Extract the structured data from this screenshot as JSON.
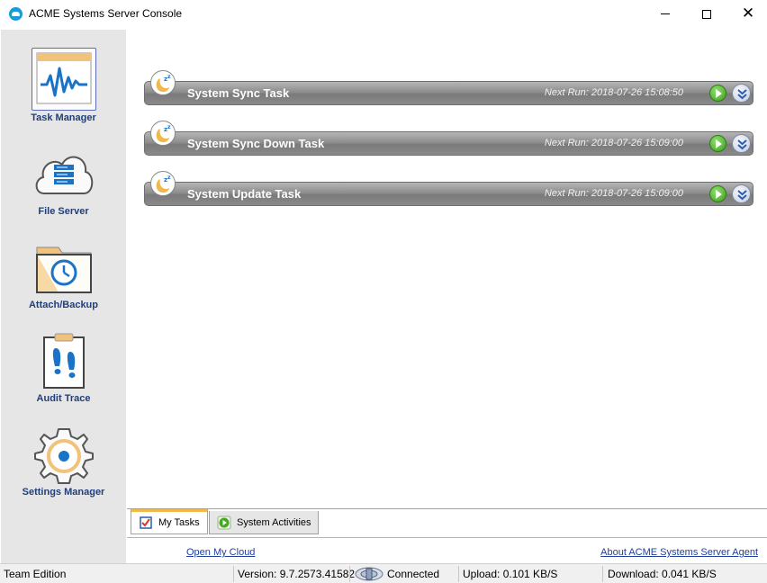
{
  "window": {
    "title": "ACME Systems Server Console",
    "icon": "cloud-icon"
  },
  "sidebar": {
    "items": [
      {
        "label": "Task Manager",
        "icon": "task-manager-icon",
        "active": true
      },
      {
        "label": "File Server",
        "icon": "file-server-icon",
        "active": false
      },
      {
        "label": "Attach/Backup",
        "icon": "attach-backup-icon",
        "active": false
      },
      {
        "label": "Audit Trace",
        "icon": "audit-trace-icon",
        "active": false
      },
      {
        "label": "Settings Manager",
        "icon": "settings-gear-icon",
        "active": false
      }
    ]
  },
  "tasks": [
    {
      "name": "System Sync Task",
      "next_run": "Next Run: 2018-07-26 15:08:50"
    },
    {
      "name": "System Sync Down Task",
      "next_run": "Next Run: 2018-07-26 15:09:00"
    },
    {
      "name": "System Update Task",
      "next_run": "Next Run: 2018-07-26 15:09:00"
    }
  ],
  "tabs": [
    {
      "label": "My Tasks",
      "icon": "checklist-icon",
      "active": true
    },
    {
      "label": "System Activities",
      "icon": "play-icon",
      "active": false
    }
  ],
  "links": {
    "open_cloud": "Open My Cloud",
    "about": "About ACME Systems Server Agent"
  },
  "status": {
    "edition": "Team Edition",
    "version": "Version: 9.7.2573.41582",
    "connection": "Connected",
    "upload": "Upload: 0.101 KB/S",
    "download": "Download: 0.041 KB/S"
  },
  "colors": {
    "sidebar_bg": "#e6e6e6",
    "nav_label": "#1f3f7a",
    "task_bar": "#8e8e8e",
    "play_green": "#3f9e1f",
    "tab_accent": "#f0b94a",
    "link": "#1f3f9a"
  }
}
